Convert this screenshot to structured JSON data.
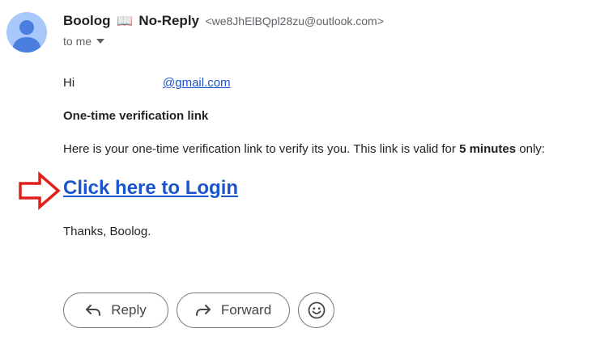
{
  "email": {
    "sender_name": "Boolog",
    "sender_emoji": "📖",
    "sender_suffix": "No-Reply",
    "sender_address": "<we8JhElBQpl28zu@outlook.com>",
    "recipient": "to me",
    "greeting": "Hi",
    "recipient_link": "@gmail.com",
    "heading": "One-time verification link",
    "instructions_prefix": "Here is your one-time verification link to verify its you. This link is valid for",
    "instructions_bold": "5 minutes",
    "instructions_suffix": "only:",
    "login_link": "Click here to Login",
    "signoff": "Thanks, Boolog."
  },
  "actions": {
    "reply": "Reply",
    "forward": "Forward"
  },
  "colors": {
    "link": "#1a55cc",
    "arrow": "#e0201b",
    "avatar_bg": "#a8c7fa",
    "avatar_fg": "#4a7fe0"
  }
}
